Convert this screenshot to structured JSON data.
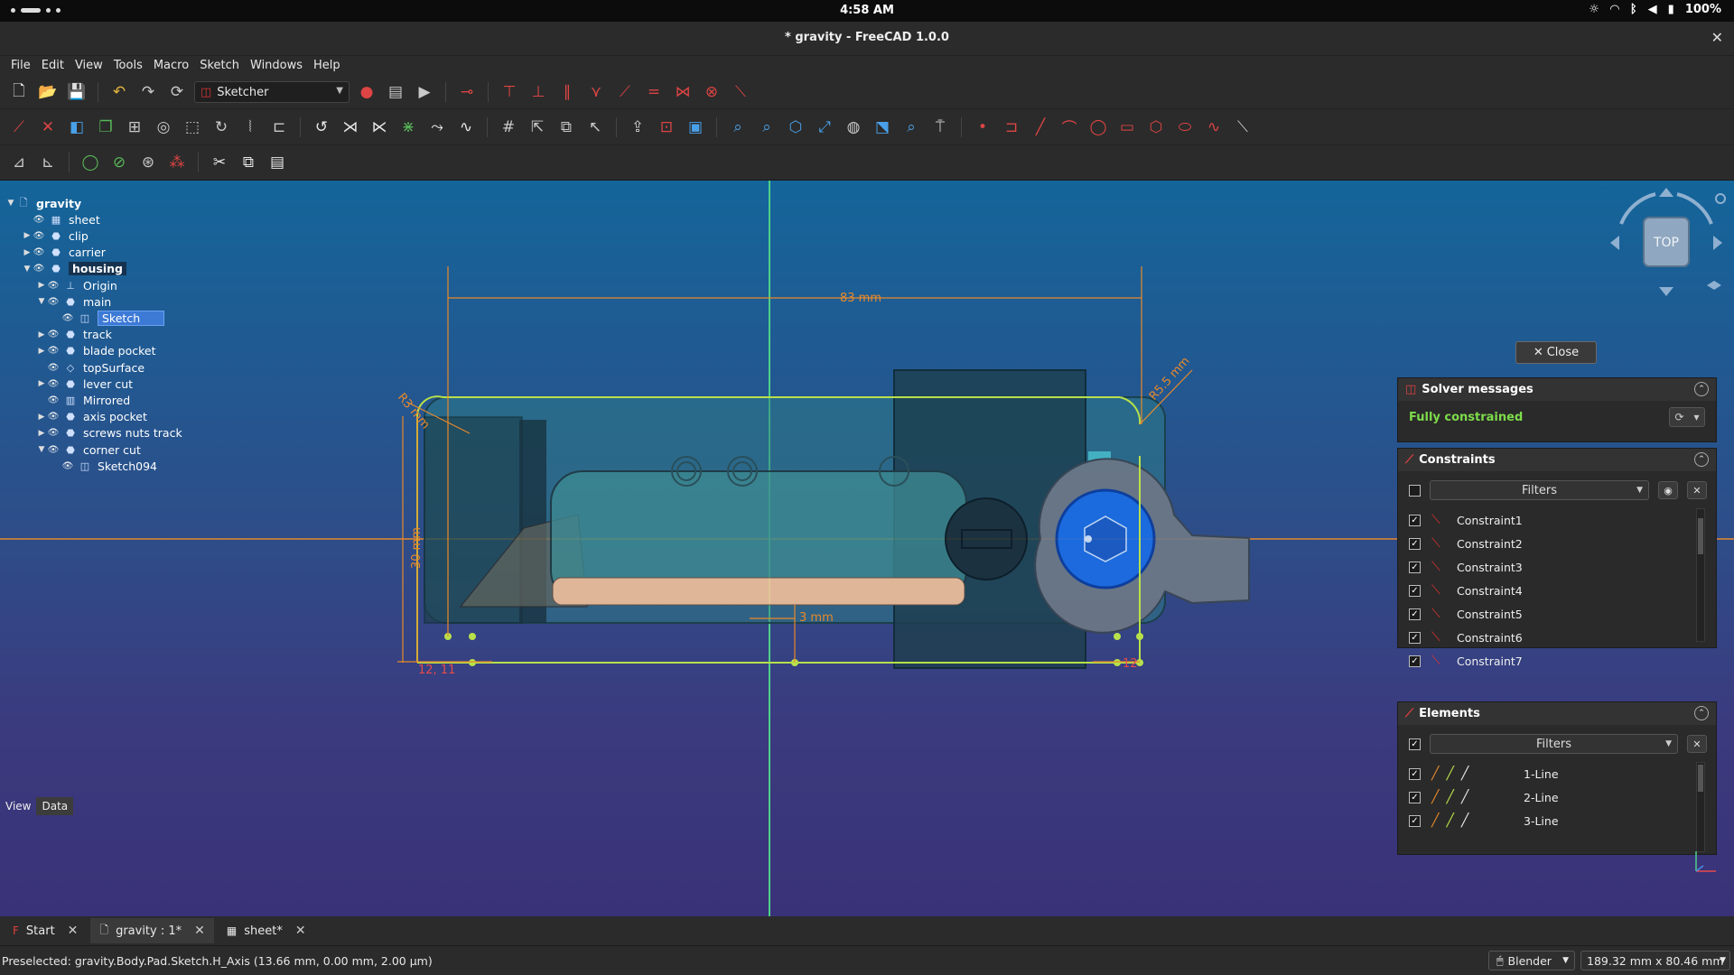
{
  "system": {
    "time": "4:58 AM",
    "battery": "100%"
  },
  "window": {
    "title": "* gravity - FreeCAD 1.0.0"
  },
  "menu": [
    "File",
    "Edit",
    "View",
    "Tools",
    "Macro",
    "Sketch",
    "Windows",
    "Help"
  ],
  "workbench": {
    "selected": "Sketcher"
  },
  "tree": {
    "root": "gravity",
    "items": [
      {
        "label": "sheet",
        "level": 1
      },
      {
        "label": "clip",
        "level": 1
      },
      {
        "label": "carrier",
        "level": 1
      },
      {
        "label": "housing",
        "level": 1
      },
      {
        "label": "Origin",
        "level": 2
      },
      {
        "label": "main",
        "level": 2
      },
      {
        "label": "Sketch",
        "level": 3
      },
      {
        "label": "track",
        "level": 2
      },
      {
        "label": "blade pocket",
        "level": 2
      },
      {
        "label": "topSurface",
        "level": 2
      },
      {
        "label": "lever cut",
        "level": 2
      },
      {
        "label": "Mirrored",
        "level": 2
      },
      {
        "label": "axis pocket",
        "level": 2
      },
      {
        "label": "screws nuts track",
        "level": 2
      },
      {
        "label": "corner cut",
        "level": 2
      },
      {
        "label": "Sketch094",
        "level": 3
      }
    ],
    "tabs": [
      "View",
      "Data"
    ]
  },
  "sketch": {
    "dim_width": "83 mm",
    "dim_radius": "R3 mm",
    "dim_radius2": "R5.5 mm",
    "dim_height": "30 mm",
    "dim_offset": "3 mm",
    "point_label": "12, 11",
    "point_label2": "12"
  },
  "navcube": {
    "face": "TOP"
  },
  "task": {
    "close_label": "Close",
    "solver_title": "Solver messages",
    "solver_status": "Fully constrained",
    "constraints_title": "Constraints",
    "constraints_filter": "Filters",
    "constraints": [
      "Constraint1",
      "Constraint2",
      "Constraint3",
      "Constraint4",
      "Constraint5",
      "Constraint6",
      "Constraint7"
    ],
    "elements_title": "Elements",
    "elements_filter": "Filters",
    "elements": [
      "1-Line",
      "2-Line",
      "3-Line"
    ]
  },
  "doctabs": [
    {
      "label": "Start"
    },
    {
      "label": "gravity : 1*"
    },
    {
      "label": "sheet*"
    }
  ],
  "status": {
    "text": "Preselected: gravity.Body.Pad.Sketch.H_Axis (13.66 mm, 0.00 mm, 2.00 µm)",
    "nav_style": "Blender",
    "dims": "189.32 mm x 80.46 mm"
  },
  "colors": {
    "constraint_orange": "#e8892a",
    "fully_constrained_green": "#7ddc4a",
    "axis_green": "#4fd08a",
    "selection_blue": "#3d7ad6"
  }
}
